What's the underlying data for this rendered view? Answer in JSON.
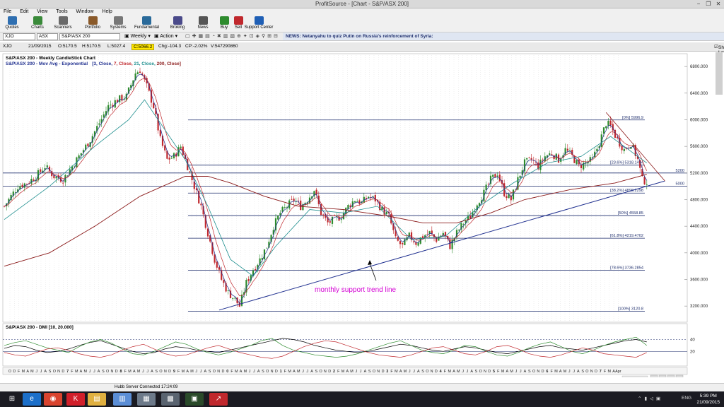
{
  "window": {
    "title": "ProfitSource - [Chart - S&P/ASX 200]",
    "controls": {
      "minimize": "−",
      "restore": "❐",
      "close": "✕"
    }
  },
  "menu": [
    "File",
    "Edit",
    "View",
    "Tools",
    "Window",
    "Help"
  ],
  "toolbar": [
    {
      "label": "Quotes",
      "icon": "quotes-icon",
      "color": "#2f6fb1"
    },
    {
      "label": "Charts",
      "icon": "charts-icon",
      "color": "#3a8a3a"
    },
    {
      "label": "Scanners",
      "icon": "scanners-icon",
      "color": "#6a6a6a"
    },
    {
      "label": "Portfolio",
      "icon": "portfolio-icon",
      "color": "#8a5a2a"
    },
    {
      "label": "Systems",
      "icon": "systems-icon",
      "color": "#777777"
    },
    {
      "label": "Fundamental",
      "icon": "fundamental-icon",
      "color": "#2a6a9a"
    },
    {
      "label": "Broking",
      "icon": "broking-icon",
      "color": "#4a4a8a"
    },
    {
      "label": "News",
      "icon": "news-icon",
      "color": "#555555"
    },
    {
      "label": "Buy",
      "icon": "buy-icon",
      "color": "#2e8b2e"
    },
    {
      "label": "Sell",
      "icon": "sell-icon",
      "color": "#c0282d"
    },
    {
      "label": "Support Center",
      "icon": "support-center-icon",
      "color": "#1f5fb5"
    }
  ],
  "commandbar": {
    "symbol": "XJO",
    "exchange": "ASX",
    "name": "S&P/ASX 200",
    "period": "Weekly",
    "action": "Action",
    "news": "NEWS: Netanyahu to quiz Putin on Russia's reinforcement of Syria:"
  },
  "info": {
    "symbol": "XJO",
    "date": "21/09/2015",
    "open": "O:5170.5",
    "high": "H:5170.5",
    "low": "L:5027.4",
    "close": "C:5066.2",
    "change": "Chg:-104.3",
    "change_pct": "CP:-2.02%",
    "volume": "V:547290860",
    "show_last": "Show Last"
  },
  "chart_data": [
    {
      "type": "candlestick",
      "title": "S&P/ASX 200 - Weekly CandleStick Chart",
      "subtitle": "S&P/ASX 200 - Mov Avg - Exponential",
      "ma_params": [
        "[3, Close, ",
        "7, Close, ",
        "21, Close, ",
        "200, Close]"
      ],
      "ma_colors": [
        "#1f2f8f",
        "#c0282d",
        "#1f8f8f",
        "#8b1a1a"
      ],
      "y_ticks": [
        3200,
        3600,
        4000,
        4400,
        4800,
        5200,
        5600,
        6000,
        6400,
        6800
      ],
      "y_tick_labels": [
        "3200.000",
        "3600.000",
        "4000.000",
        "4400.000",
        "4800.000",
        "5200.000",
        "5600.000",
        "6000.000",
        "6400.000",
        "6800.000"
      ],
      "ylim": [
        3000,
        6950
      ],
      "fib_levels": [
        {
          "label": "[0%] 5996.9",
          "value": 5996.9
        },
        {
          "label": "[23.6%] 5318.1404",
          "value": 5318.1404
        },
        {
          "label": "[38.2%] 4898.2298",
          "value": 4898.2298
        },
        {
          "label": "[50%] 4558.85",
          "value": 4558.85
        },
        {
          "label": "[61.8%] 4219.4702",
          "value": 4219.4702
        },
        {
          "label": "[78.6%] 3736.2854",
          "value": 3736.2854
        },
        {
          "label": "[100%] 3120.8",
          "value": 3120.8
        }
      ],
      "horizontal_lines": [
        {
          "label": "5200",
          "value": 5200
        },
        {
          "label": "5000",
          "value": 5000
        }
      ],
      "annotation": "monthly support trend line",
      "x_labels": [
        "O",
        "D",
        "F",
        "M",
        "A",
        "M",
        "J",
        "J",
        "A",
        "S",
        "O",
        "N",
        "D",
        "7",
        "F",
        "M",
        "A",
        "M",
        "J",
        "J",
        "A",
        "S",
        "O",
        "N",
        "D",
        "8",
        "F",
        "M",
        "A",
        "M",
        "J",
        "J",
        "A",
        "S",
        "O",
        "N",
        "D",
        "9",
        "F",
        "M",
        "A",
        "M",
        "J",
        "J",
        "A",
        "S",
        "O",
        "N",
        "D",
        "0",
        "F",
        "M",
        "A",
        "M",
        "J",
        "J",
        "A",
        "S",
        "O",
        "N",
        "D",
        "1",
        "F",
        "M",
        "A",
        "M",
        "J",
        "J",
        "A",
        "S",
        "O",
        "N",
        "D",
        "2",
        "F",
        "M",
        "A",
        "M",
        "J",
        "J",
        "A",
        "S",
        "O",
        "N",
        "D",
        "3",
        "F",
        "M",
        "A",
        "M",
        "J",
        "J",
        "A",
        "S",
        "O",
        "N",
        "D",
        "4",
        "F",
        "M",
        "A",
        "M",
        "J",
        "J",
        "A",
        "S",
        "O",
        "N",
        "D",
        "5",
        "F",
        "M",
        "A",
        "M",
        "J",
        "J",
        "A",
        "S",
        "O",
        "N",
        "D",
        "6",
        "F",
        "M",
        "A",
        "M",
        "J",
        "J",
        "A",
        "S",
        "O",
        "N",
        "D",
        "7",
        "F",
        "M",
        "A",
        "Apr"
      ],
      "close_path": [
        [
          0,
          4700
        ],
        [
          6,
          5000
        ],
        [
          10,
          5050
        ],
        [
          14,
          5150
        ],
        [
          18,
          5300
        ],
        [
          22,
          5150
        ],
        [
          26,
          5100
        ],
        [
          30,
          5300
        ],
        [
          34,
          5500
        ],
        [
          38,
          5700
        ],
        [
          42,
          5950
        ],
        [
          46,
          6200
        ],
        [
          50,
          6300
        ],
        [
          54,
          6350
        ],
        [
          58,
          6700
        ],
        [
          60,
          6750
        ],
        [
          63,
          6500
        ],
        [
          66,
          6200
        ],
        [
          69,
          5700
        ],
        [
          72,
          5400
        ],
        [
          75,
          5450
        ],
        [
          78,
          5600
        ],
        [
          81,
          5300
        ],
        [
          84,
          5000
        ],
        [
          87,
          4700
        ],
        [
          90,
          4300
        ],
        [
          93,
          3900
        ],
        [
          96,
          3600
        ],
        [
          99,
          3400
        ],
        [
          102,
          3300
        ],
        [
          104,
          3200
        ],
        [
          107,
          3550
        ],
        [
          110,
          3750
        ],
        [
          113,
          3900
        ],
        [
          116,
          4100
        ],
        [
          119,
          4400
        ],
        [
          122,
          4600
        ],
        [
          125,
          4700
        ],
        [
          128,
          4800
        ],
        [
          131,
          4700
        ],
        [
          134,
          4800
        ],
        [
          137,
          4950
        ],
        [
          140,
          4600
        ],
        [
          143,
          4450
        ],
        [
          146,
          4500
        ],
        [
          149,
          4550
        ],
        [
          152,
          4700
        ],
        [
          155,
          4800
        ],
        [
          158,
          4750
        ],
        [
          161,
          4850
        ],
        [
          164,
          4800
        ],
        [
          167,
          4650
        ],
        [
          170,
          4550
        ],
        [
          173,
          4200
        ],
        [
          176,
          4100
        ],
        [
          179,
          4250
        ],
        [
          182,
          4150
        ],
        [
          185,
          4250
        ],
        [
          188,
          4300
        ],
        [
          191,
          4200
        ],
        [
          194,
          4300
        ],
        [
          197,
          4100
        ],
        [
          200,
          4300
        ],
        [
          203,
          4450
        ],
        [
          206,
          4550
        ],
        [
          209,
          4750
        ],
        [
          212,
          4900
        ],
        [
          215,
          5100
        ],
        [
          218,
          5200
        ],
        [
          221,
          4900
        ],
        [
          224,
          4800
        ],
        [
          227,
          5100
        ],
        [
          230,
          5350
        ],
        [
          233,
          5400
        ],
        [
          236,
          5300
        ],
        [
          239,
          5450
        ],
        [
          242,
          5500
        ],
        [
          245,
          5400
        ],
        [
          248,
          5550
        ],
        [
          251,
          5450
        ],
        [
          254,
          5300
        ],
        [
          257,
          5350
        ],
        [
          260,
          5400
        ],
        [
          263,
          5650
        ],
        [
          266,
          5950
        ],
        [
          268,
          5900
        ],
        [
          271,
          5700
        ],
        [
          274,
          5550
        ],
        [
          277,
          5650
        ],
        [
          280,
          5400
        ],
        [
          282,
          5100
        ],
        [
          284,
          5066
        ]
      ],
      "ma_200_path": [
        [
          0,
          3800
        ],
        [
          20,
          4000
        ],
        [
          40,
          4400
        ],
        [
          60,
          4850
        ],
        [
          80,
          5150
        ],
        [
          90,
          5150
        ],
        [
          100,
          5050
        ],
        [
          115,
          4850
        ],
        [
          130,
          4700
        ],
        [
          150,
          4650
        ],
        [
          170,
          4550
        ],
        [
          185,
          4450
        ],
        [
          200,
          4450
        ],
        [
          215,
          4600
        ],
        [
          230,
          4800
        ],
        [
          250,
          4950
        ],
        [
          270,
          5050
        ],
        [
          284,
          5180
        ]
      ],
      "ma_21_path": [
        [
          0,
          4500
        ],
        [
          20,
          5000
        ],
        [
          40,
          5600
        ],
        [
          55,
          6000
        ],
        [
          62,
          6300
        ],
        [
          70,
          5900
        ],
        [
          80,
          5400
        ],
        [
          90,
          4700
        ],
        [
          100,
          3900
        ],
        [
          110,
          3650
        ],
        [
          120,
          4100
        ],
        [
          135,
          4650
        ],
        [
          150,
          4600
        ],
        [
          165,
          4700
        ],
        [
          180,
          4200
        ],
        [
          195,
          4250
        ],
        [
          210,
          4700
        ],
        [
          225,
          5050
        ],
        [
          240,
          5350
        ],
        [
          255,
          5450
        ],
        [
          268,
          5750
        ],
        [
          284,
          5350
        ]
      ],
      "trendline": {
        "start": [
          95,
          3140
        ],
        "end": [
          292,
          5080
        ]
      },
      "wedge_upper": {
        "start": [
          266,
          6110
        ],
        "end": [
          292,
          5080
        ]
      }
    },
    {
      "type": "line",
      "title": "S&P/ASX 200 - DMI [10, 20.000]",
      "y_tick_labels": [
        "40",
        "20"
      ],
      "y_ticks": [
        40,
        20
      ],
      "ylim": [
        0,
        55
      ],
      "series_colors": [
        "#000000",
        "#2e8b2e",
        "#c0282d"
      ],
      "series": [
        {
          "values": [
            25,
            30,
            28,
            22,
            18,
            20,
            24,
            30,
            35,
            38,
            32,
            26,
            20,
            16,
            18,
            24,
            28,
            26,
            22,
            20,
            18,
            22,
            26,
            30,
            34,
            38,
            42,
            40,
            36,
            30,
            26,
            22,
            20,
            18,
            20,
            24,
            28,
            32,
            30,
            26,
            22,
            20,
            24,
            28,
            26,
            22,
            18,
            16,
            20,
            24,
            28,
            30,
            26,
            24,
            22,
            26,
            30,
            34,
            38,
            40,
            36
          ]
        },
        {
          "values": [
            30,
            35,
            38,
            32,
            26,
            22,
            18,
            28,
            36,
            40,
            34,
            24,
            16,
            14,
            20,
            28,
            36,
            32,
            24,
            18,
            14,
            18,
            24,
            30,
            38,
            42,
            30,
            22,
            18,
            14,
            12,
            10,
            12,
            16,
            22,
            28,
            34,
            38,
            30,
            22,
            18,
            16,
            22,
            30,
            28,
            20,
            14,
            12,
            18,
            26,
            32,
            36,
            28,
            20,
            16,
            22,
            30,
            36,
            40,
            44,
            30
          ]
        },
        {
          "values": [
            18,
            14,
            12,
            18,
            24,
            26,
            22,
            16,
            12,
            10,
            14,
            22,
            28,
            32,
            24,
            16,
            12,
            14,
            20,
            26,
            30,
            24,
            18,
            14,
            10,
            8,
            12,
            20,
            28,
            34,
            38,
            36,
            30,
            24,
            18,
            14,
            12,
            10,
            14,
            20,
            26,
            28,
            22,
            16,
            14,
            20,
            28,
            30,
            24,
            16,
            12,
            10,
            14,
            20,
            26,
            22,
            16,
            14,
            12,
            10,
            18
          ]
        }
      ]
    }
  ],
  "status": {
    "server": "Hubb Server Connected 17:24:09"
  },
  "taskbar": {
    "apps": [
      {
        "icon": "start-icon",
        "glyph": "⊞",
        "color": "#1b1b22"
      },
      {
        "icon": "internet-explorer-icon",
        "glyph": "e",
        "color": "#1c6fc9"
      },
      {
        "icon": "chrome-icon",
        "glyph": "◉",
        "color": "#d9442f"
      },
      {
        "icon": "k-app-icon",
        "glyph": "K",
        "color": "#d11f2a"
      },
      {
        "icon": "file-explorer-icon",
        "glyph": "▤",
        "color": "#e0b040"
      },
      {
        "icon": "document-icon",
        "glyph": "▥",
        "color": "#5b8ed6"
      },
      {
        "icon": "photo-icon",
        "glyph": "▦",
        "color": "#6d7a8a"
      },
      {
        "icon": "calculator-icon",
        "glyph": "▩",
        "color": "#5a6470"
      },
      {
        "icon": "terminal-icon",
        "glyph": "▣",
        "color": "#2a4a2a"
      },
      {
        "icon": "profitsource-icon",
        "glyph": "↗",
        "color": "#c0282d"
      }
    ],
    "lang": "ENG",
    "time": "5:39 PM",
    "date": "21/09/2015"
  }
}
